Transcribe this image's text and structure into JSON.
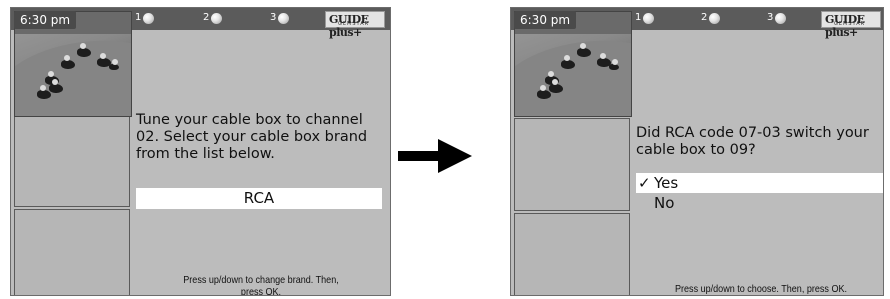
{
  "screen1": {
    "time": "6:30 pm",
    "channels": [
      "1",
      "2",
      "3"
    ],
    "logo_text": "GUIDE plus+",
    "logo_sub": "GEMSTAR",
    "message": "Tune your cable box to channel 02. Select your cable box brand from the list below.",
    "selected_brand": "RCA",
    "help": "Press up/down to change brand. Then, press OK."
  },
  "screen2": {
    "time": "6:30 pm",
    "channels": [
      "1",
      "2",
      "3"
    ],
    "logo_text": "GUIDE plus+",
    "logo_sub": "GEMSTAR",
    "question": "Did RCA code 07-03 switch your cable box to 09?",
    "options": [
      {
        "check": "✓",
        "label": "Yes",
        "selected": true
      },
      {
        "check": "",
        "label": "No",
        "selected": false
      }
    ],
    "help": "Press up/down to choose. Then, press OK."
  },
  "arrow_icon": "right-arrow-icon"
}
